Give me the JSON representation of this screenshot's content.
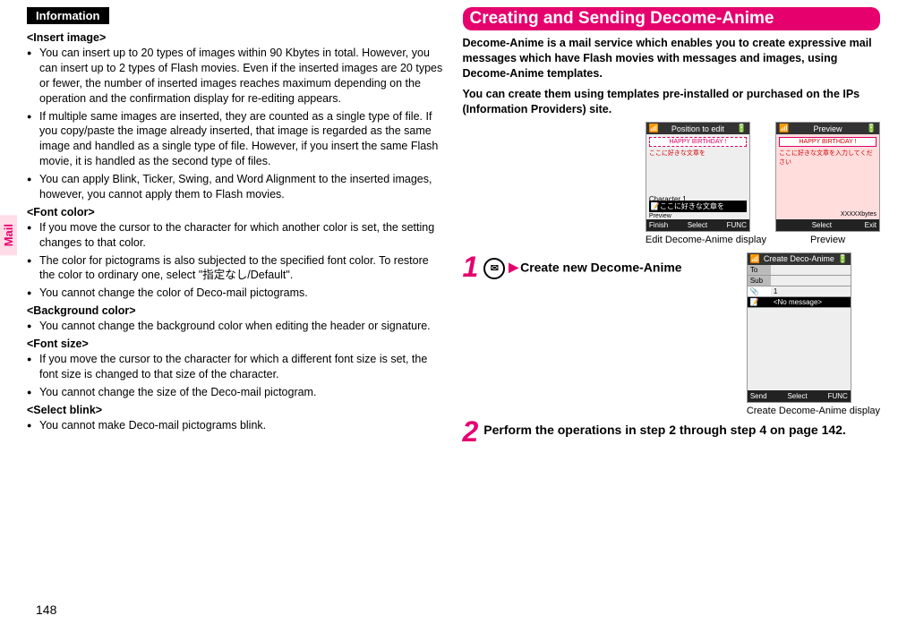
{
  "sideTab": "Mail",
  "left": {
    "infoHeader": "Information",
    "sections": [
      {
        "title": "<Insert image>",
        "items": [
          "You can insert up to 20 types of images within 90 Kbytes in total. However, you can insert up to 2 types of Flash movies. Even if the inserted images are 20 types or fewer, the number of inserted images reaches maximum depending on the operation and the confirmation display for re-editing appears.",
          "If multiple same images are inserted, they are counted as a single type of file. If you copy/paste the image already inserted, that image is regarded as the same image and handled as a single type of file. However, if you insert the same Flash movie, it is handled as the second type of files.",
          "You can apply Blink, Ticker, Swing, and Word Alignment to the inserted images, however, you cannot apply them to Flash movies."
        ]
      },
      {
        "title": "<Font color>",
        "items": [
          "If you move the cursor to the character for which another color is set, the setting changes to that color.",
          "The color for pictograms is also subjected to the specified font color. To restore the color to ordinary one, select \"指定なし/Default\".",
          "You cannot change the color of Deco-mail pictograms."
        ]
      },
      {
        "title": "<Background color>",
        "items": [
          "You cannot change the background color when editing the header or signature."
        ]
      },
      {
        "title": "<Font size>",
        "items": [
          "If you move the cursor to the character for which a different font size is set, the font size is changed to that size of the character.",
          "You cannot change the size of the Deco-mail pictogram."
        ]
      },
      {
        "title": "<Select blink>",
        "items": [
          "You cannot make Deco-mail pictograms blink."
        ]
      }
    ]
  },
  "right": {
    "header": "Creating and Sending Decome-Anime",
    "intro1": "Decome-Anime is a mail service which enables you to create expressive mail messages which have Flash movies with messages and images, using Decome-Anime templates.",
    "intro2": "You can create them using templates pre-installed or purchased on the IPs (Information Providers) site.",
    "shots": {
      "edit": {
        "bar": "Position to edit",
        "happy": "HAPPY BIRTHDAY !",
        "bodyLine": "ここに好きな文章を",
        "charLine": "Character 1",
        "stripText": "ここに好きな文章を",
        "softLeft": "Finish",
        "softMid": "Select",
        "softRight": "FUNC",
        "softPrev": "Preview",
        "caption": "Edit Decome-Anime display"
      },
      "preview": {
        "bar": "Preview",
        "happy": "HAPPY BIRTHDAY !",
        "bodyLine": "ここに好きな文章を入力してください",
        "sizeLabel": "XXXXXbytes",
        "softLeft": "",
        "softMid": "Select",
        "softRight": "Exit",
        "caption": "Preview"
      },
      "create": {
        "bar": "Create Deco-Anime",
        "rowTo": "To",
        "rowSub": "Sub",
        "rowFile": "1",
        "rowMsg": "<No message>",
        "softLeft": "Send",
        "softMid": "Select",
        "softRight": "FUNC",
        "caption": "Create Decome-Anime display"
      }
    },
    "step1": {
      "num": "1",
      "arrow": "▶",
      "text": "Create new Decome-Anime"
    },
    "step2": {
      "num": "2",
      "text": "Perform the operations in step 2 through step 4 on page 142."
    }
  },
  "pageNum": "148"
}
